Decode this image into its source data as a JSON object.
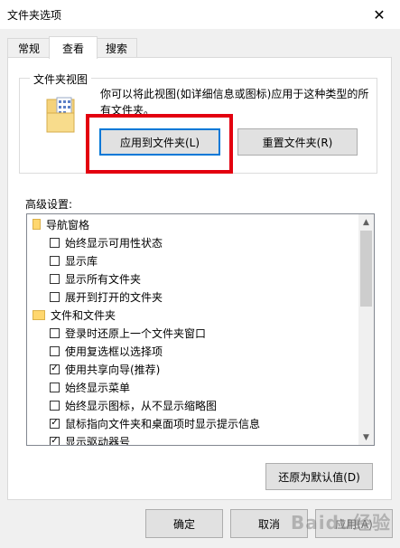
{
  "window": {
    "title": "文件夹选项"
  },
  "tabs": [
    {
      "label": "常规",
      "active": false
    },
    {
      "label": "查看",
      "active": true
    },
    {
      "label": "搜索",
      "active": false
    }
  ],
  "folder_view": {
    "legend": "文件夹视图",
    "description": "你可以将此视图(如详细信息或图标)应用于这种类型的所有文件夹。",
    "apply_button": "应用到文件夹(L)",
    "reset_button": "重置文件夹(R)"
  },
  "advanced": {
    "label": "高级设置:",
    "items": [
      {
        "type": "folder",
        "label": "导航窗格"
      },
      {
        "type": "checkbox",
        "label": "始终显示可用性状态",
        "checked": false
      },
      {
        "type": "checkbox",
        "label": "显示库",
        "checked": false
      },
      {
        "type": "checkbox",
        "label": "显示所有文件夹",
        "checked": false
      },
      {
        "type": "checkbox",
        "label": "展开到打开的文件夹",
        "checked": false
      },
      {
        "type": "folder",
        "label": "文件和文件夹"
      },
      {
        "type": "checkbox",
        "label": "登录时还原上一个文件夹窗口",
        "checked": false
      },
      {
        "type": "checkbox",
        "label": "使用复选框以选择项",
        "checked": false
      },
      {
        "type": "checkbox",
        "label": "使用共享向导(推荐)",
        "checked": true
      },
      {
        "type": "checkbox",
        "label": "始终显示菜单",
        "checked": false
      },
      {
        "type": "checkbox",
        "label": "始终显示图标，从不显示缩略图",
        "checked": false
      },
      {
        "type": "checkbox",
        "label": "鼠标指向文件夹和桌面项时显示提示信息",
        "checked": true
      },
      {
        "type": "checkbox",
        "label": "显示驱动器号",
        "checked": true
      }
    ],
    "restore_button": "还原为默认值(D)"
  },
  "footer": {
    "ok": "确定",
    "cancel": "取消",
    "apply": "应用(A)"
  },
  "watermark": "Baidu经验",
  "colors": {
    "highlight": "#e3000f",
    "accent": "#0078d7"
  }
}
